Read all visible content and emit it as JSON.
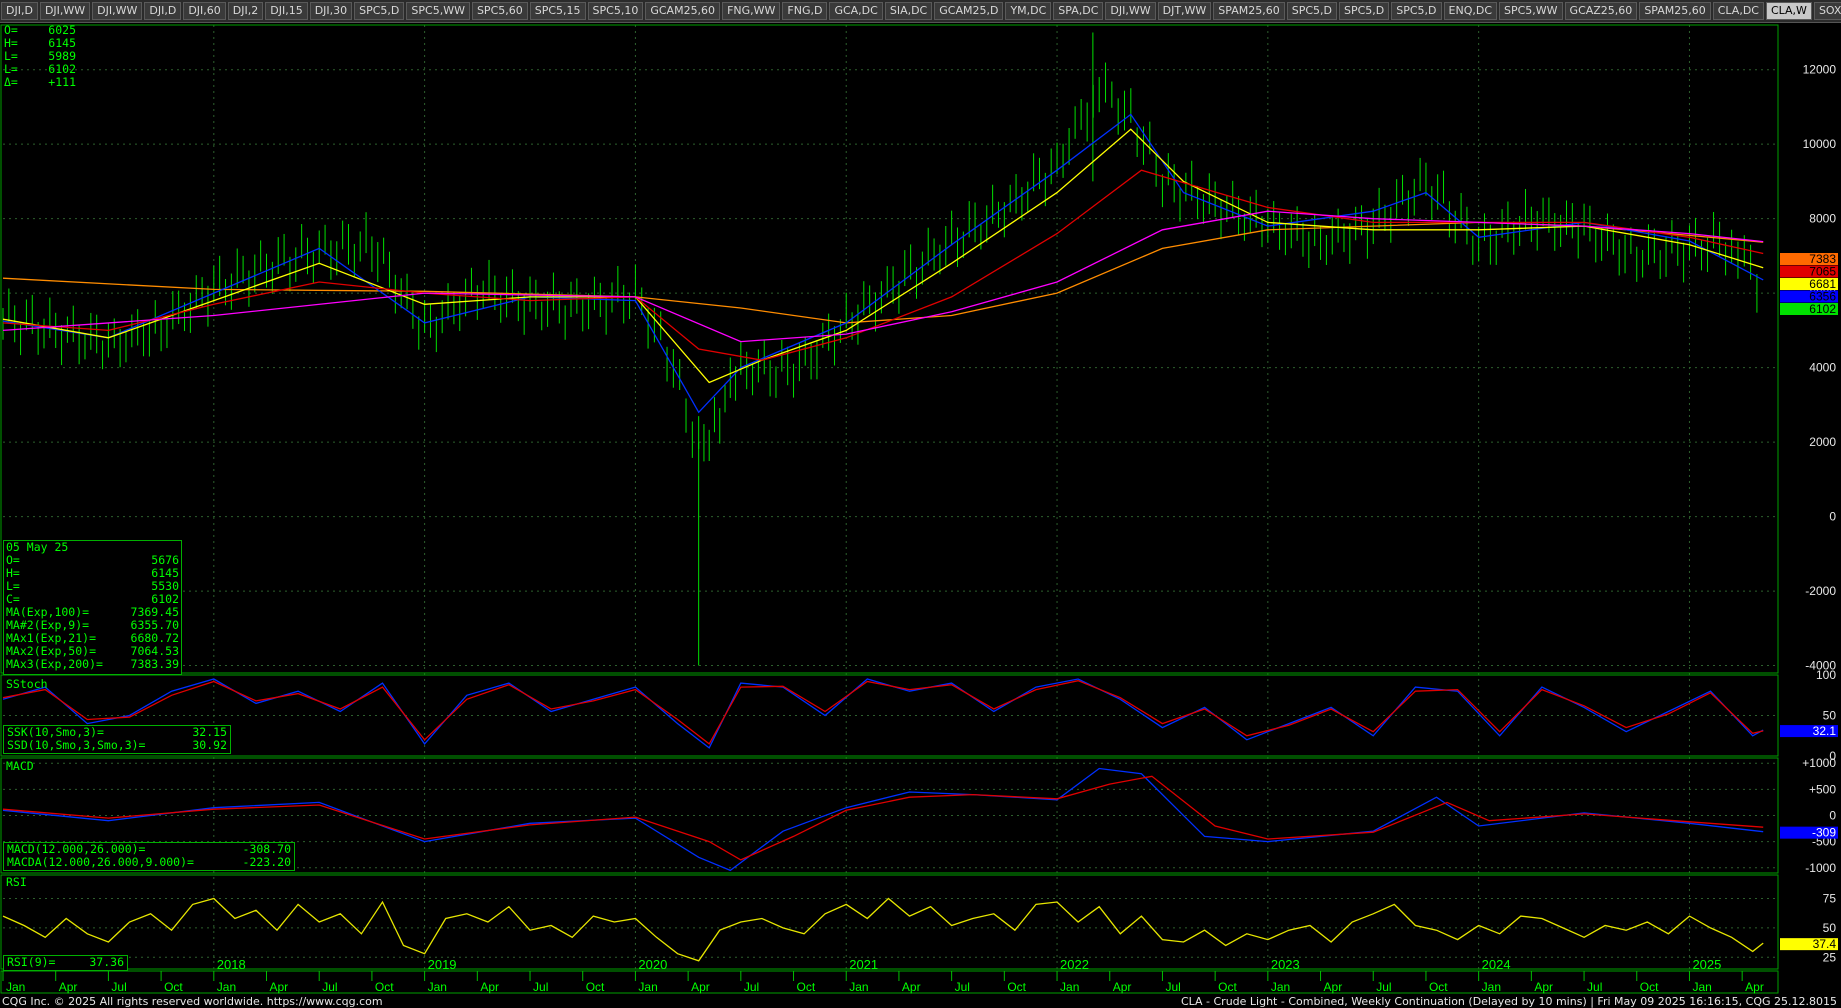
{
  "tabs": [
    "DJI,D",
    "DJI,WW",
    "DJI,WW",
    "DJI,D",
    "DJI,60",
    "DJI,2",
    "DJI,15",
    "DJI,30",
    "SPC5,D",
    "SPC5,WW",
    "SPC5,60",
    "SPC5,15",
    "SPC5,10",
    "GCAM25,60",
    "FNG,WW",
    "FNG,D",
    "GCA,DC",
    "SIA,DC",
    "GCAM25,D",
    "YM,DC",
    "SPA,DC",
    "DJI,WW",
    "DJT,WW",
    "SPAM25,60",
    "SPC5,D",
    "SPC5,D",
    "SPC5,D",
    "ENQ,DC",
    "SPC5,WW",
    "GCAZ25,60",
    "SPAM25,60",
    "CLA,DC",
    "CLA,W",
    "SOX,WW",
    "+"
  ],
  "active_tab": "CLA,W",
  "top_ohlc": {
    "rows": [
      {
        "label": "O=",
        "value": "6025"
      },
      {
        "label": "H=",
        "value": "6145"
      },
      {
        "label": "L=",
        "value": "5989"
      },
      {
        "label": "L=",
        "value": "6102"
      },
      {
        "label": "Δ=",
        "value": "+111"
      }
    ]
  },
  "databox": {
    "date": "05 May 25",
    "rows": [
      {
        "label": "O=",
        "value": "5676"
      },
      {
        "label": "H=",
        "value": "6145"
      },
      {
        "label": "L=",
        "value": "5530"
      },
      {
        "label": "C=",
        "value": "6102"
      },
      {
        "label": "MA(Exp,100)=",
        "value": "7369.45"
      },
      {
        "label": "MA#2(Exp,9)=",
        "value": "6355.70"
      },
      {
        "label": "MAx1(Exp,21)=",
        "value": "6680.72"
      },
      {
        "label": "MAx2(Exp,50)=",
        "value": "7064.53"
      },
      {
        "label": "MAx3(Exp,200)=",
        "value": "7383.39"
      }
    ]
  },
  "sstoch": {
    "title": "SStoch",
    "rows": [
      {
        "label": "SSK(10,Smo,3)=",
        "value": "32.15"
      },
      {
        "label": "SSD(10,Smo,3,Smo,3)=",
        "value": "30.92"
      }
    ],
    "badge": "32.1"
  },
  "macd": {
    "title": "MACD",
    "rows": [
      {
        "label": "MACD(12.000,26.000)=",
        "value": "-308.70"
      },
      {
        "label": "MACDA(12.000,26.000,9.000)=",
        "value": "-223.20"
      }
    ],
    "badge": "-309"
  },
  "rsi": {
    "title": "RSI",
    "rows": [
      {
        "label": "RSI(9)=",
        "value": "37.36"
      }
    ],
    "badge": "37.4"
  },
  "price_badges": [
    {
      "text": "7383",
      "color": "#ff6a00"
    },
    {
      "text": "7065",
      "color": "#e00000"
    },
    {
      "text": "6681",
      "color": "#ffff00"
    },
    {
      "text": "6356",
      "color": "#0000ff"
    },
    {
      "text": "6102",
      "color": "#00e000"
    }
  ],
  "chart_data": [
    {
      "type": "ohlc",
      "title": "",
      "y_ticks": [
        "12000",
        "10000",
        "8000",
        "6000",
        "4000",
        "2000",
        "0",
        "-2000",
        "-4000"
      ],
      "ylim": [
        -4200,
        13200
      ],
      "series": [
        {
          "name": "Price",
          "color": "#00ff00",
          "x": [
            2017.0,
            2017.25,
            2017.5,
            2017.75,
            2018.0,
            2018.25,
            2018.5,
            2018.75,
            2019.0,
            2019.25,
            2019.5,
            2019.75,
            2020.0,
            2020.15,
            2020.3,
            2020.4,
            2020.5,
            2020.75,
            2021.0,
            2021.25,
            2021.5,
            2021.75,
            2022.0,
            2022.2,
            2022.35,
            2022.5,
            2022.75,
            2023.0,
            2023.25,
            2023.5,
            2023.75,
            2024.0,
            2024.25,
            2024.5,
            2024.75,
            2025.0,
            2025.2,
            2025.35
          ],
          "values": [
            5300,
            5000,
            4600,
            5100,
            6100,
            6700,
            7100,
            7300,
            5000,
            6100,
            5700,
            5600,
            6000,
            4500,
            1800,
            2800,
            4000,
            3900,
            5200,
            6300,
            7400,
            8200,
            9500,
            11500,
            10800,
            9000,
            8400,
            7800,
            7400,
            7800,
            9000,
            7300,
            8000,
            7700,
            7000,
            7200,
            7400,
            6102
          ]
        },
        {
          "name": "MA(Exp,100)",
          "color": "#ff8c00",
          "x": [
            2017.0,
            2018.0,
            2019.0,
            2020.0,
            2020.5,
            2021.0,
            2021.5,
            2022.0,
            2022.5,
            2023.0,
            2023.5,
            2024.0,
            2024.5,
            2025.0,
            2025.35
          ],
          "values": [
            6400,
            6100,
            6050,
            5900,
            5600,
            5200,
            5400,
            6000,
            7200,
            7700,
            7800,
            7900,
            7800,
            7550,
            7369
          ]
        },
        {
          "name": "MA#2(Exp,9)",
          "color": "#0030ff",
          "x": [
            2017.0,
            2017.5,
            2018.0,
            2018.5,
            2019.0,
            2019.5,
            2020.0,
            2020.3,
            2020.5,
            2021.0,
            2021.5,
            2022.0,
            2022.35,
            2022.6,
            2023.0,
            2023.5,
            2023.75,
            2024.0,
            2024.5,
            2025.0,
            2025.35
          ],
          "values": [
            5250,
            4800,
            6000,
            7200,
            5200,
            5900,
            5800,
            2800,
            4000,
            5200,
            7300,
            9300,
            10800,
            8700,
            7800,
            8200,
            8700,
            7500,
            7900,
            7400,
            6356
          ]
        },
        {
          "name": "MAx1(Exp,21)",
          "color": "#ffff00",
          "x": [
            2017.0,
            2017.5,
            2018.0,
            2018.5,
            2019.0,
            2019.5,
            2020.0,
            2020.35,
            2020.6,
            2021.0,
            2021.5,
            2022.0,
            2022.35,
            2022.6,
            2023.0,
            2023.5,
            2024.0,
            2024.5,
            2025.0,
            2025.35
          ],
          "values": [
            5300,
            4800,
            5800,
            6800,
            5700,
            5900,
            5900,
            3600,
            4200,
            5000,
            6800,
            8700,
            10400,
            9000,
            7900,
            7700,
            7700,
            7800,
            7300,
            6681
          ]
        },
        {
          "name": "MAx2(Exp,50)",
          "color": "#e00000",
          "x": [
            2017.0,
            2017.5,
            2018.0,
            2018.5,
            2019.0,
            2019.5,
            2020.0,
            2020.3,
            2020.6,
            2021.0,
            2021.5,
            2022.0,
            2022.4,
            2022.7,
            2023.0,
            2023.5,
            2024.0,
            2024.5,
            2025.0,
            2025.35
          ],
          "values": [
            5200,
            5000,
            5700,
            6300,
            6000,
            5800,
            5900,
            4500,
            4200,
            4800,
            5900,
            7600,
            9300,
            8800,
            8300,
            7900,
            7900,
            7900,
            7500,
            7065
          ]
        },
        {
          "name": "MAx3(Exp,200)",
          "color": "#ff00ff",
          "x": [
            2017.0,
            2018.0,
            2019.0,
            2020.0,
            2020.5,
            2021.0,
            2021.5,
            2022.0,
            2022.5,
            2023.0,
            2023.5,
            2024.0,
            2024.5,
            2025.0,
            2025.35
          ],
          "values": [
            5000,
            5400,
            6000,
            5900,
            4700,
            4900,
            5500,
            6300,
            7700,
            8200,
            8000,
            7900,
            7800,
            7600,
            7383
          ]
        }
      ]
    },
    {
      "type": "line",
      "title": "SStoch",
      "y_ticks": [
        "100",
        "50",
        "0"
      ],
      "ylim": [
        0,
        100
      ],
      "series": [
        {
          "name": "SSK(10,Smo,3)",
          "color": "#0030ff",
          "x": [
            2017.0,
            2017.2,
            2017.4,
            2017.6,
            2017.8,
            2018.0,
            2018.2,
            2018.4,
            2018.6,
            2018.8,
            2019.0,
            2019.2,
            2019.4,
            2019.6,
            2019.8,
            2020.0,
            2020.2,
            2020.35,
            2020.5,
            2020.7,
            2020.9,
            2021.1,
            2021.3,
            2021.5,
            2021.7,
            2021.9,
            2022.1,
            2022.3,
            2022.5,
            2022.7,
            2022.9,
            2023.1,
            2023.3,
            2023.5,
            2023.7,
            2023.9,
            2024.1,
            2024.3,
            2024.5,
            2024.7,
            2024.9,
            2025.1,
            2025.3,
            2025.35
          ],
          "values": [
            70,
            85,
            40,
            50,
            80,
            95,
            65,
            80,
            55,
            90,
            15,
            75,
            90,
            55,
            70,
            85,
            40,
            10,
            90,
            85,
            50,
            95,
            80,
            90,
            55,
            85,
            95,
            70,
            35,
            60,
            20,
            40,
            60,
            25,
            85,
            80,
            25,
            85,
            60,
            30,
            55,
            80,
            25,
            32
          ]
        },
        {
          "name": "SSD(10,Smo,3,Smo,3)",
          "color": "#e00000",
          "x": [
            2017.0,
            2017.2,
            2017.4,
            2017.6,
            2017.8,
            2018.0,
            2018.2,
            2018.4,
            2018.6,
            2018.8,
            2019.0,
            2019.2,
            2019.4,
            2019.6,
            2019.8,
            2020.0,
            2020.2,
            2020.35,
            2020.5,
            2020.7,
            2020.9,
            2021.1,
            2021.3,
            2021.5,
            2021.7,
            2021.9,
            2022.1,
            2022.3,
            2022.5,
            2022.7,
            2022.9,
            2023.1,
            2023.3,
            2023.5,
            2023.7,
            2023.9,
            2024.1,
            2024.3,
            2024.5,
            2024.7,
            2024.9,
            2025.1,
            2025.3,
            2025.35
          ],
          "values": [
            72,
            82,
            45,
            48,
            75,
            92,
            68,
            77,
            58,
            85,
            20,
            70,
            88,
            58,
            68,
            82,
            45,
            15,
            85,
            86,
            55,
            92,
            82,
            88,
            58,
            82,
            93,
            72,
            40,
            58,
            25,
            38,
            58,
            30,
            80,
            82,
            30,
            82,
            62,
            35,
            52,
            78,
            28,
            31
          ]
        }
      ]
    },
    {
      "type": "line",
      "title": "MACD",
      "y_ticks": [
        "+1000",
        "+500",
        "0",
        "-500",
        "-1000"
      ],
      "ylim": [
        -1100,
        1100
      ],
      "series": [
        {
          "name": "MACD(12.000,26.000)",
          "color": "#0030ff",
          "x": [
            2017.0,
            2017.5,
            2018.0,
            2018.5,
            2019.0,
            2019.5,
            2020.0,
            2020.3,
            2020.45,
            2020.7,
            2021.0,
            2021.3,
            2021.6,
            2022.0,
            2022.2,
            2022.4,
            2022.7,
            2023.0,
            2023.5,
            2023.8,
            2024.0,
            2024.5,
            2025.0,
            2025.35
          ],
          "values": [
            100,
            -100,
            150,
            250,
            -500,
            -150,
            -50,
            -800,
            -1050,
            -300,
            150,
            450,
            400,
            300,
            900,
            800,
            -400,
            -500,
            -300,
            350,
            -200,
            50,
            -150,
            -309
          ]
        },
        {
          "name": "MACDA(12.000,26.000,9.000)",
          "color": "#e00000",
          "x": [
            2017.0,
            2017.5,
            2018.0,
            2018.5,
            2019.0,
            2019.5,
            2020.0,
            2020.35,
            2020.5,
            2020.75,
            2021.0,
            2021.3,
            2021.6,
            2022.0,
            2022.25,
            2022.45,
            2022.75,
            2023.0,
            2023.5,
            2023.85,
            2024.05,
            2024.5,
            2025.0,
            2025.35
          ],
          "values": [
            120,
            -50,
            120,
            200,
            -450,
            -180,
            -30,
            -500,
            -850,
            -400,
            100,
            350,
            400,
            320,
            600,
            750,
            -200,
            -450,
            -320,
            250,
            -100,
            30,
            -120,
            -223
          ]
        }
      ]
    },
    {
      "type": "line",
      "title": "RSI",
      "y_ticks": [
        "75",
        "50",
        "25"
      ],
      "ylim": [
        15,
        95
      ],
      "series": [
        {
          "name": "RSI(9)",
          "color": "#e6e600",
          "x": [
            2017.0,
            2017.1,
            2017.2,
            2017.3,
            2017.4,
            2017.5,
            2017.6,
            2017.7,
            2017.8,
            2017.9,
            2018.0,
            2018.1,
            2018.2,
            2018.3,
            2018.4,
            2018.5,
            2018.6,
            2018.7,
            2018.8,
            2018.9,
            2019.0,
            2019.1,
            2019.2,
            2019.3,
            2019.4,
            2019.5,
            2019.6,
            2019.7,
            2019.8,
            2019.9,
            2020.0,
            2020.1,
            2020.2,
            2020.3,
            2020.4,
            2020.5,
            2020.6,
            2020.7,
            2020.8,
            2020.9,
            2021.0,
            2021.1,
            2021.2,
            2021.3,
            2021.4,
            2021.5,
            2021.6,
            2021.7,
            2021.8,
            2021.9,
            2022.0,
            2022.1,
            2022.2,
            2022.3,
            2022.4,
            2022.5,
            2022.6,
            2022.7,
            2022.8,
            2022.9,
            2023.0,
            2023.1,
            2023.2,
            2023.3,
            2023.4,
            2023.5,
            2023.6,
            2023.7,
            2023.8,
            2023.9,
            2024.0,
            2024.1,
            2024.2,
            2024.3,
            2024.4,
            2024.5,
            2024.6,
            2024.7,
            2024.8,
            2024.9,
            2025.0,
            2025.1,
            2025.2,
            2025.3,
            2025.35
          ],
          "values": [
            60,
            52,
            42,
            58,
            45,
            38,
            55,
            62,
            48,
            70,
            75,
            58,
            65,
            48,
            70,
            55,
            62,
            45,
            72,
            35,
            28,
            58,
            62,
            55,
            68,
            48,
            52,
            42,
            60,
            55,
            58,
            42,
            28,
            22,
            48,
            55,
            58,
            50,
            45,
            62,
            70,
            58,
            75,
            60,
            68,
            52,
            58,
            62,
            48,
            70,
            72,
            55,
            68,
            45,
            60,
            40,
            38,
            48,
            35,
            45,
            40,
            48,
            52,
            38,
            55,
            62,
            70,
            52,
            48,
            40,
            52,
            45,
            60,
            58,
            50,
            42,
            52,
            48,
            55,
            45,
            60,
            50,
            42,
            30,
            37
          ]
        }
      ]
    }
  ],
  "time_axis": {
    "labels": [
      "Jan",
      "Apr",
      "Jul",
      "Oct",
      "Jan",
      "Apr",
      "Jul",
      "Oct",
      "Jan",
      "Apr",
      "Jul",
      "Oct",
      "Jan",
      "Apr",
      "Jul",
      "Oct",
      "Jan",
      "Apr",
      "Jul",
      "Oct",
      "Jan",
      "Apr",
      "Jul",
      "Oct",
      "Jan",
      "Apr",
      "Jul",
      "Oct",
      "Jan",
      "Apr",
      "Jul",
      "Oct",
      "Jan",
      "Apr"
    ],
    "years": [
      "2018",
      "2019",
      "2020",
      "2021",
      "2022",
      "2023",
      "2024",
      "2025"
    ]
  },
  "footer": {
    "left": "CQG Inc. © 2025 All rights reserved worldwide. https://www.cqg.com",
    "right": "CLA - Crude Light - Combined, Weekly Continuation (Delayed by 10 mins) | Fri May 09 2025 16:16:15, CQG 25.12.8015"
  }
}
